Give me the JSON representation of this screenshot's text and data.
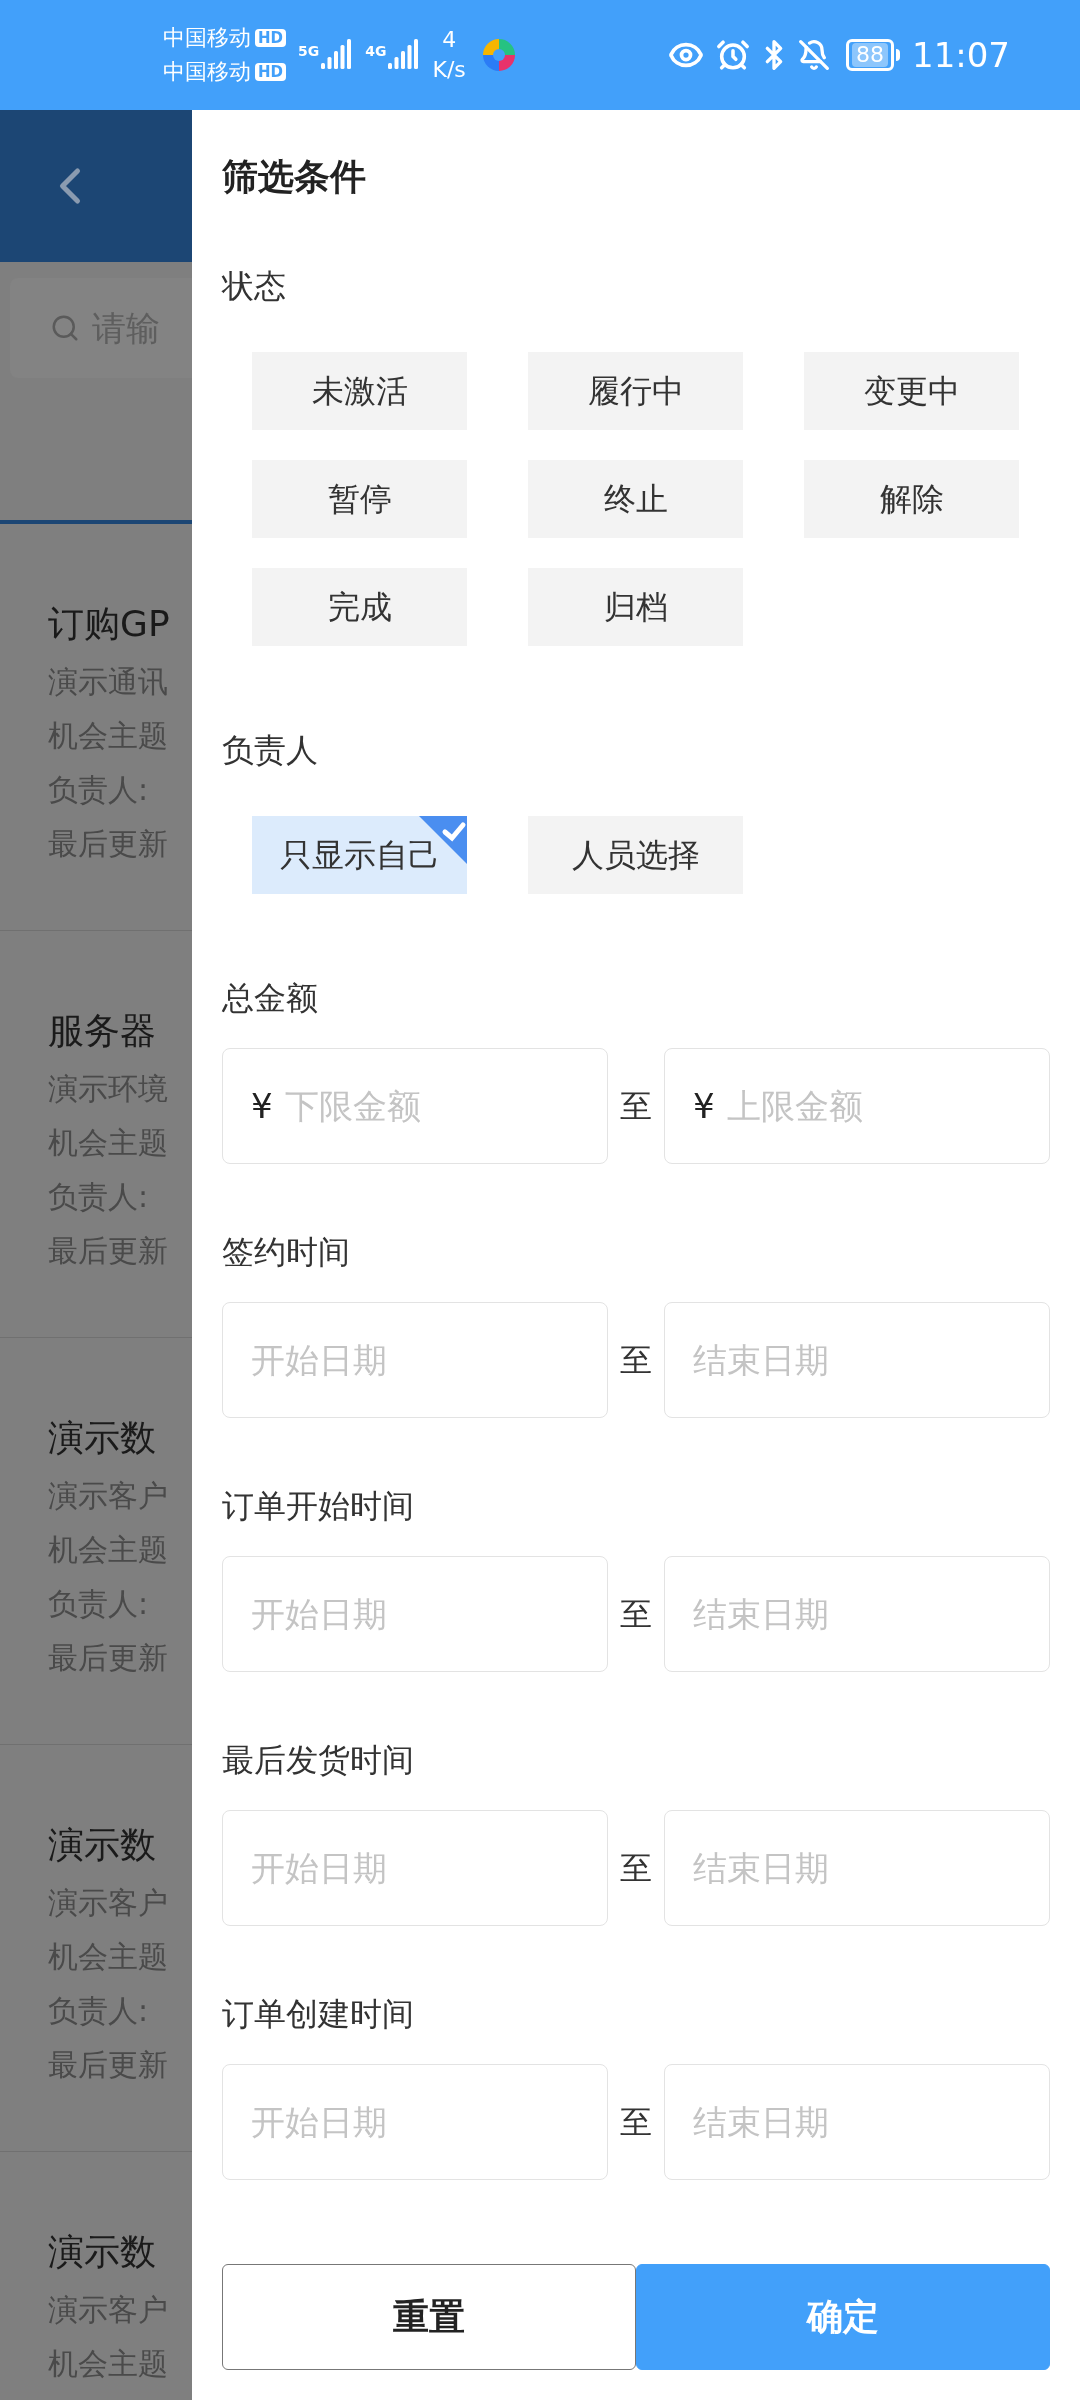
{
  "status_bar": {
    "carriers": [
      {
        "name": "中国移动",
        "badge": "HD"
      },
      {
        "name": "中国移动",
        "badge": "HD"
      }
    ],
    "networks": [
      "5G",
      "4G"
    ],
    "speed_value": "4",
    "speed_unit": "K/s",
    "battery": "88",
    "time": "11:07"
  },
  "background": {
    "search": {
      "placeholder": "请输"
    },
    "list": [
      {
        "title": "订购GP",
        "lines": [
          "演示通讯",
          "机会主题",
          "负责人:",
          "最后更新"
        ]
      },
      {
        "title": "服务器",
        "lines": [
          "演示环境",
          "机会主题",
          "负责人:",
          "最后更新"
        ]
      },
      {
        "title": "演示数",
        "lines": [
          "演示客户",
          "机会主题",
          "负责人:",
          "最后更新"
        ]
      },
      {
        "title": "演示数",
        "lines": [
          "演示客户",
          "机会主题",
          "负责人:",
          "最后更新"
        ]
      },
      {
        "title": "演示数",
        "lines": [
          "演示客户",
          "机会主题"
        ]
      }
    ]
  },
  "drawer": {
    "title": "筛选条件",
    "sections": [
      {
        "kind": "tags",
        "label": "状态",
        "tags": [
          {
            "label": "未激活",
            "selected": false
          },
          {
            "label": "履行中",
            "selected": false
          },
          {
            "label": "变更中",
            "selected": false
          },
          {
            "label": "暂停",
            "selected": false
          },
          {
            "label": "终止",
            "selected": false
          },
          {
            "label": "解除",
            "selected": false
          },
          {
            "label": "完成",
            "selected": false
          },
          {
            "label": "归档",
            "selected": false
          }
        ]
      },
      {
        "kind": "tags",
        "label": "负责人",
        "tags": [
          {
            "label": "只显示自己",
            "selected": true
          },
          {
            "label": "人员选择",
            "selected": false
          }
        ]
      },
      {
        "kind": "range",
        "label": "总金额",
        "from": {
          "prefix": "¥",
          "placeholder": "下限金额"
        },
        "separator": "至",
        "to": {
          "prefix": "¥",
          "placeholder": "上限金额"
        }
      },
      {
        "kind": "range",
        "label": "签约时间",
        "from": {
          "placeholder": "开始日期"
        },
        "separator": "至",
        "to": {
          "placeholder": "结束日期"
        }
      },
      {
        "kind": "range",
        "label": "订单开始时间",
        "from": {
          "placeholder": "开始日期"
        },
        "separator": "至",
        "to": {
          "placeholder": "结束日期"
        }
      },
      {
        "kind": "range",
        "label": "最后发货时间",
        "from": {
          "placeholder": "开始日期"
        },
        "separator": "至",
        "to": {
          "placeholder": "结束日期"
        }
      },
      {
        "kind": "range",
        "label": "订单创建时间",
        "from": {
          "placeholder": "开始日期"
        },
        "separator": "至",
        "to": {
          "placeholder": "结束日期"
        }
      }
    ],
    "buttons": [
      {
        "label": "重置",
        "kind": "secondary"
      },
      {
        "label": "确定",
        "kind": "primary"
      }
    ]
  }
}
